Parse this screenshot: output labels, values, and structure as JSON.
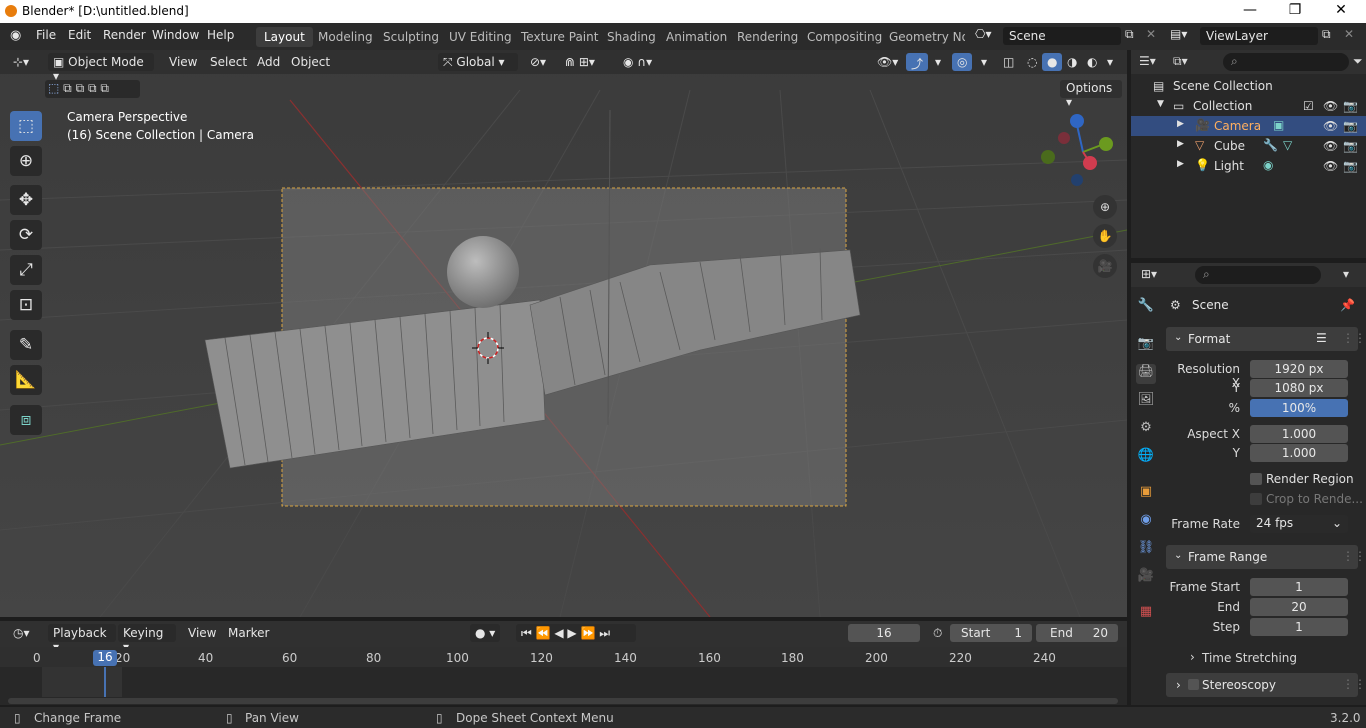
{
  "titlebar": {
    "title": "Blender* [D:\\untitled.blend]",
    "min": "—",
    "max": "❐",
    "close": "✕"
  },
  "menubar": {
    "items": [
      "File",
      "Edit",
      "Render",
      "Window",
      "Help"
    ]
  },
  "workspaces": [
    "Layout",
    "Modeling",
    "Sculpting",
    "UV Editing",
    "Texture Paint",
    "Shading",
    "Animation",
    "Rendering",
    "Compositing",
    "Geometry Noc"
  ],
  "scene": {
    "name": "Scene",
    "view_layer": "ViewLayer"
  },
  "viewport_header": {
    "mode": "Object Mode",
    "menus": [
      "View",
      "Select",
      "Add",
      "Object"
    ],
    "orientation": "Global",
    "options": "Options"
  },
  "viewport": {
    "line1": "Camera Perspective",
    "line2": "(16) Scene Collection | Camera"
  },
  "outliner": {
    "root": "Scene Collection",
    "collection": "Collection",
    "items": [
      "Camera",
      "Cube",
      "Light"
    ]
  },
  "properties": {
    "tab_title": "Scene",
    "format_title": "Format",
    "res_x_label": "Resolution X",
    "res_x": "1920 px",
    "res_y_label": "Y",
    "res_y": "1080 px",
    "pct_label": "%",
    "pct": "100%",
    "aspect_x_label": "Aspect X",
    "aspect_x": "1.000",
    "aspect_y_label": "Y",
    "aspect_y": "1.000",
    "render_region": "Render Region",
    "crop": "Crop to Rende...",
    "frame_rate_label": "Frame Rate",
    "frame_rate": "24 fps",
    "frame_range_title": "Frame Range",
    "frame_start_label": "Frame Start",
    "frame_start": "1",
    "end_label": "End",
    "end": "20",
    "step_label": "Step",
    "step": "1",
    "time_stretching": "Time Stretching",
    "stereoscopy": "Stereoscopy"
  },
  "timeline": {
    "menus": [
      "Playback",
      "Keying",
      "View",
      "Marker"
    ],
    "current_frame": "16",
    "start_label": "Start",
    "start": "1",
    "end_label": "End",
    "end": "20",
    "ticks": [
      "0",
      "20",
      "40",
      "60",
      "80",
      "100",
      "120",
      "140",
      "160",
      "180",
      "200",
      "220",
      "240"
    ],
    "playhead": "16"
  },
  "statusbar": {
    "item1": "Change Frame",
    "item2": "Pan View",
    "item3": "Dope Sheet Context Menu",
    "version": "3.2.0"
  }
}
